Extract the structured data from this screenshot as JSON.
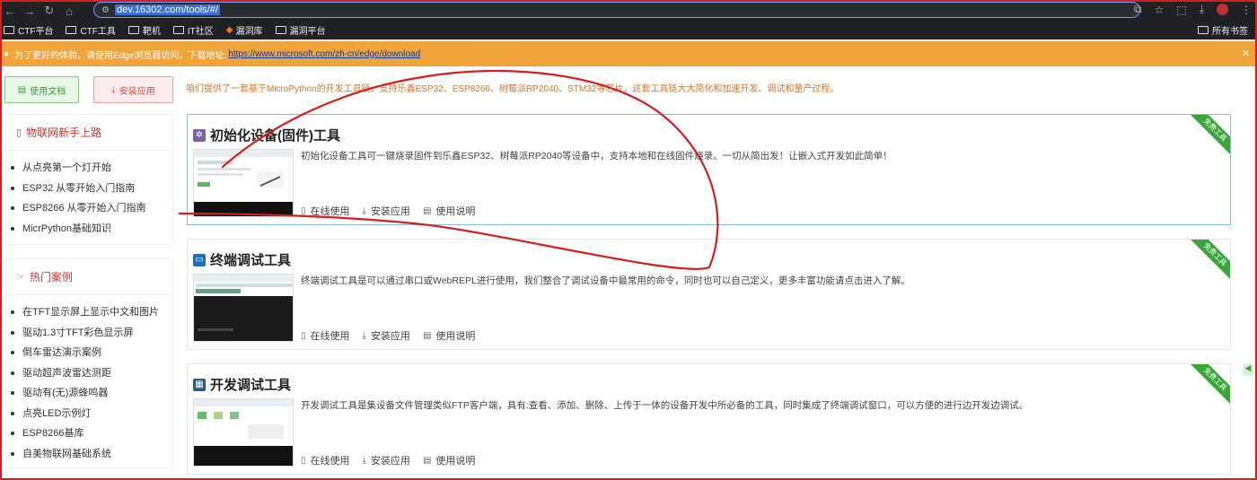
{
  "browser": {
    "url": "dev.16302.com/tools/#/",
    "bookmarks": [
      "CTF平台",
      "CTF工具",
      "靶机",
      "IT社区",
      "漏洞库",
      "漏洞平台"
    ],
    "bookmarks_right": "所有书签"
  },
  "notice": {
    "text": "为了更好的体验，请使用Edge浏览器访问。下载地址:",
    "link": "https://www.microsoft.com/zh-cn/edge/download"
  },
  "sidebar": {
    "doc_button": "使用文档",
    "install_button": "安装应用",
    "panel1": {
      "title": "物联网新手上路",
      "items": [
        "从点亮第一个灯开始",
        "ESP32 从零开始入门指南",
        "ESP8266 从零开始入门指南",
        "MicrPython基础知识"
      ]
    },
    "panel2": {
      "title": "热门案例",
      "items": [
        "在TFT显示屏上显示中文和图片",
        "驱动1.3寸TFT彩色显示屏",
        "倒车雷达演示案例",
        "驱动超声波雷达测距",
        "驱动有(无)源蜂鸣器",
        "点亮LED示例灯",
        "ESP8266基库",
        "自美物联网基础系统"
      ]
    }
  },
  "main": {
    "intro": "咱们提供了一套基于MicroPython的开发工具链，支持乐鑫ESP32、ESP8266、树莓派RP2040、STM32等芯片，这套工具链大大简化和加速开发、调试和量产过程。",
    "action_online": "在线使用",
    "action_install": "安装应用",
    "action_manual": "使用说明",
    "ribbon": "免费工具",
    "cards": [
      {
        "title": "初始化设备(固件)工具",
        "desc": "初始化设备工具可一键烧录固件到乐鑫ESP32、树莓派RP2040等设备中，支持本地和在线固件烧录。一切从简出发！让嵌入式开发如此简单！"
      },
      {
        "title": "终端调试工具",
        "desc": "终端调试工具是可以通过串口或WebREPL进行使用，我们整合了调试设备中最常用的命令，同时也可以自己定义，更多丰富功能请点击进入了解。"
      },
      {
        "title": "开发调试工具",
        "desc": "开发调试工具是集设备文件管理类似FTP客户端，具有:查看、添加、删除、上传于一体的设备开发中所必备的工具，同时集成了终端调试窗口，可以方便的进行边开发边调试。"
      }
    ]
  },
  "colors": {
    "accent_orange": "#f0a43a",
    "ribbon_green": "#3aa53a",
    "title_red": "#c0392b",
    "annotation_red": "#d21f1f"
  },
  "icons": [
    "back-arrow-icon",
    "forward-arrow-icon",
    "reload-icon",
    "home-icon",
    "site-info-icon",
    "star-icon",
    "folder-icon",
    "fire-icon",
    "close-icon",
    "book-icon",
    "thumb-icon",
    "mouse-icon",
    "download-icon",
    "manual-icon"
  ]
}
